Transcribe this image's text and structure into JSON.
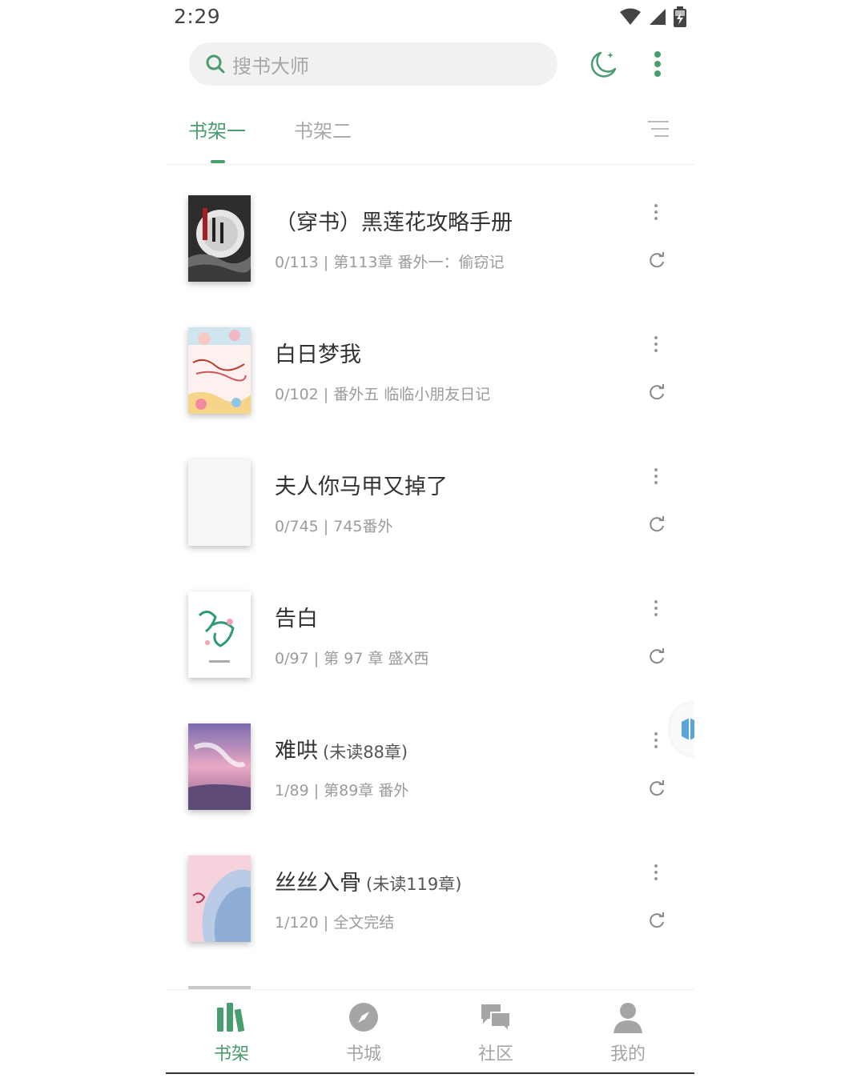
{
  "status_bar": {
    "time": "2:29",
    "icons": [
      "wifi-icon",
      "signal-icon",
      "battery-charging-icon"
    ]
  },
  "search": {
    "placeholder": "搜书大师",
    "icon": "search-icon"
  },
  "toolbar": {
    "night_mode_icon": "moon-icon",
    "more_icon": "more-vertical-icon"
  },
  "tabs": [
    {
      "label": "书架一",
      "active": true
    },
    {
      "label": "书架二",
      "active": false
    }
  ],
  "list_menu_icon": "list-menu-icon",
  "books": [
    {
      "title": "（穿书）黑莲花攻略手册",
      "unread": "",
      "progress": "0/113 | 第113章 番外一：偷窃记"
    },
    {
      "title": "白日梦我",
      "unread": "",
      "progress": "0/102 | 番外五 临临小朋友日记"
    },
    {
      "title": "夫人你马甲又掉了",
      "unread": "",
      "progress": "0/745 | 745番外"
    },
    {
      "title": "告白",
      "unread": "",
      "progress": "0/97 | 第 97 章 盛X西"
    },
    {
      "title": "难哄",
      "unread": "(未读88章)",
      "progress": "1/89 | 第89章 番外"
    },
    {
      "title": "丝丝入骨",
      "unread": "(未读119章)",
      "progress": "1/120 | 全文完结"
    }
  ],
  "bottom_nav": [
    {
      "label": "书架",
      "icon": "bookshelf-icon",
      "active": true
    },
    {
      "label": "书城",
      "icon": "compass-icon",
      "active": false
    },
    {
      "label": "社区",
      "icon": "chat-bubbles-icon",
      "active": false
    },
    {
      "label": "我的",
      "icon": "user-icon",
      "active": false
    }
  ],
  "colors": {
    "accent": "#4a9d6e",
    "inactive": "#a5a5a5",
    "search_bg": "#f1f1f1"
  }
}
